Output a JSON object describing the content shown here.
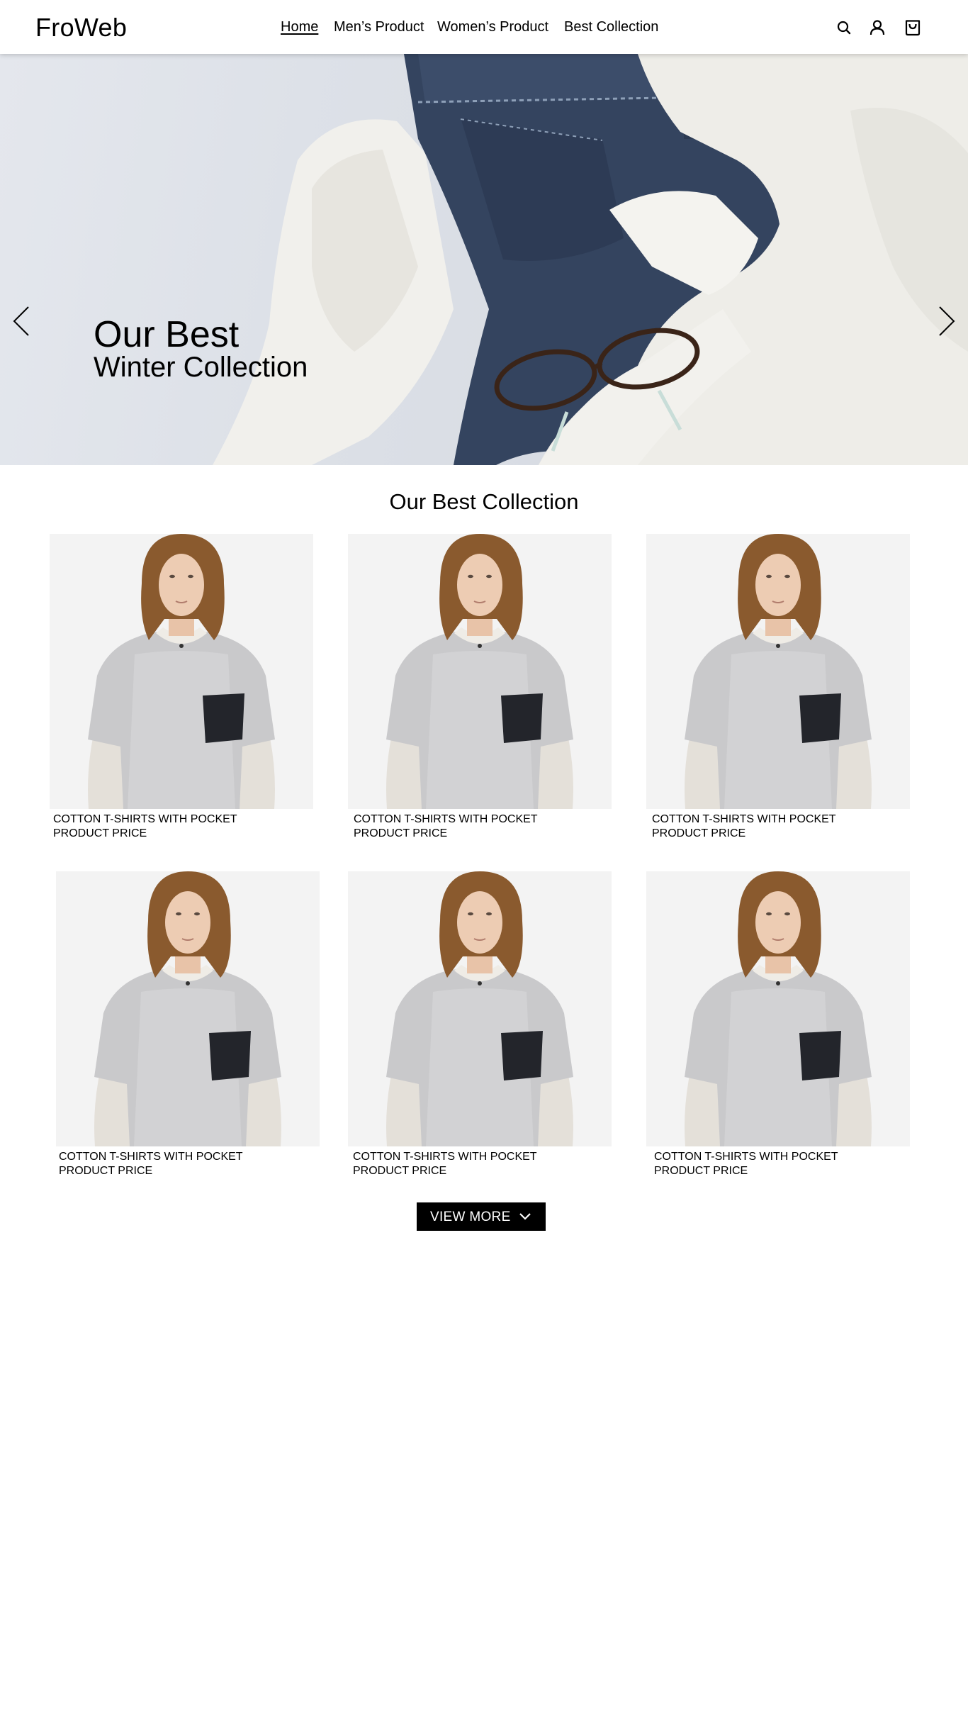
{
  "header": {
    "logo": "FroWeb",
    "nav": [
      {
        "label": "Home",
        "active": true
      },
      {
        "label": "Men’s Product",
        "active": false
      },
      {
        "label": "Women’s Product",
        "active": false
      },
      {
        "label": "Best Collection",
        "active": false
      }
    ],
    "icons": [
      "search-icon",
      "user-icon",
      "shopping-bag-icon"
    ]
  },
  "hero": {
    "title": "Our Best",
    "subtitle": "Winter Collection",
    "prev_icon": "chevron-left-icon",
    "next_icon": "chevron-right-icon"
  },
  "collection": {
    "title": "Our Best Collection",
    "products": [
      {
        "name": "COTTON T-SHIRTS WITH POCKET",
        "price": "PRODUCT PRICE"
      },
      {
        "name": "COTTON T-SHIRTS WITH POCKET",
        "price": "PRODUCT PRICE"
      },
      {
        "name": "COTTON T-SHIRTS WITH POCKET",
        "price": "PRODUCT PRICE"
      },
      {
        "name": "COTTON T-SHIRTS WITH POCKET",
        "price": "PRODUCT PRICE"
      },
      {
        "name": "COTTON T-SHIRTS WITH POCKET",
        "price": "PRODUCT PRICE"
      },
      {
        "name": "COTTON T-SHIRTS WITH POCKET",
        "price": "PRODUCT PRICE"
      }
    ],
    "view_more": "VIEW MORE",
    "view_more_icon": "chevron-down-icon"
  }
}
